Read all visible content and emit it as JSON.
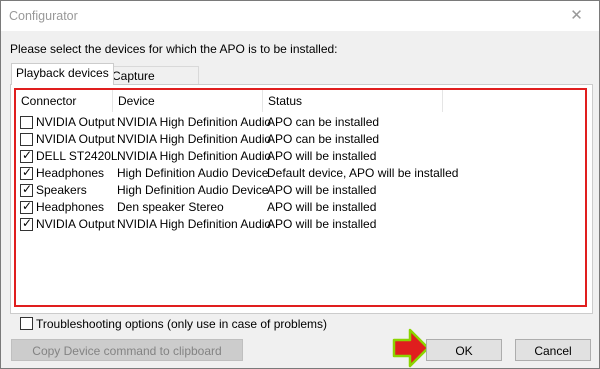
{
  "window": {
    "title": "Configurator",
    "close_glyph": "✕"
  },
  "instruction": "Please select the devices for which the APO is to be installed:",
  "tabs": [
    {
      "label": "Playback devices",
      "active": true
    },
    {
      "label": "Capture devices",
      "active": false
    }
  ],
  "columns": [
    "Connector",
    "Device",
    "Status"
  ],
  "rows": [
    {
      "checked": false,
      "connector": "NVIDIA Output",
      "device": "NVIDIA High Definition Audio",
      "status": "APO can be installed"
    },
    {
      "checked": false,
      "connector": "NVIDIA Output",
      "device": "NVIDIA High Definition Audio",
      "status": "APO can be installed"
    },
    {
      "checked": true,
      "connector": "DELL ST2420L",
      "device": "NVIDIA High Definition Audio",
      "status": "APO will be installed"
    },
    {
      "checked": true,
      "connector": "Headphones",
      "device": "High Definition Audio Device",
      "status": "Default device, APO will be installed"
    },
    {
      "checked": true,
      "connector": "Speakers",
      "device": "High Definition Audio Device",
      "status": "APO will be installed"
    },
    {
      "checked": true,
      "connector": "Headphones",
      "device": "Den speaker Stereo",
      "status": "APO will be installed"
    },
    {
      "checked": true,
      "connector": "NVIDIA Output",
      "device": "NVIDIA High Definition Audio",
      "status": "APO will be installed"
    }
  ],
  "troubleshooting": {
    "label": "Troubleshooting options (only use in case of problems)",
    "checked": false
  },
  "buttons": {
    "copy": "Copy Device command to clipboard",
    "ok": "OK",
    "cancel": "Cancel"
  },
  "colors": {
    "highlight": "#e01e1e",
    "arrow_fill": "#e01e1e",
    "arrow_outline": "#8bd400"
  },
  "icons": {
    "checkbox_tick": "✓",
    "ok_pointer": "arrow-right-icon"
  }
}
